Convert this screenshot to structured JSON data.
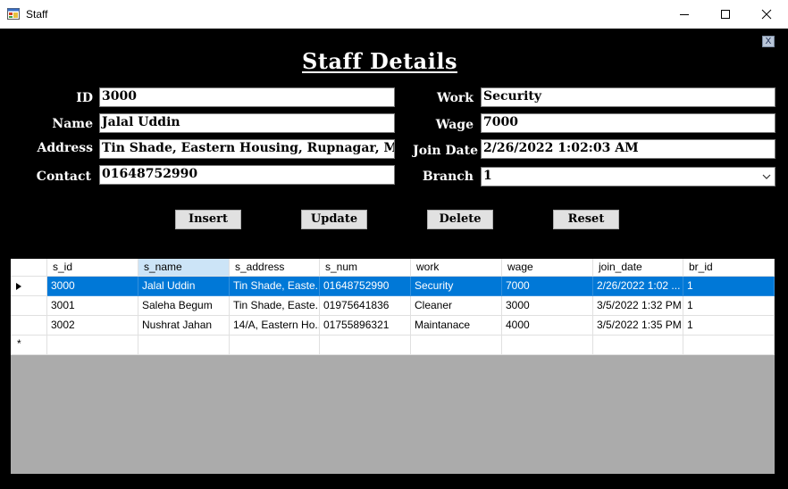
{
  "window": {
    "title": "Staff"
  },
  "form": {
    "heading": "Staff Details",
    "close_glyph": "X",
    "labels": {
      "id": "ID",
      "name": "Name",
      "address": "Address",
      "contact": "Contact",
      "work": "Work",
      "wage": "Wage",
      "join_date": "Join Date",
      "branch": "Branch"
    },
    "values": {
      "id": "3000",
      "name": "Jalal Uddin",
      "address": "Tin Shade, Eastern Housing, Rupnagar, Mirp",
      "contact": "01648752990",
      "work": "Security",
      "wage": "7000",
      "join_date": "2/26/2022 1:02:03 AM",
      "branch": "1"
    },
    "buttons": {
      "insert": "Insert",
      "update": "Update",
      "delete": "Delete",
      "reset": "Reset"
    }
  },
  "grid": {
    "columns": [
      "s_id",
      "s_name",
      "s_address",
      "s_num",
      "work",
      "wage",
      "join_date",
      "br_id"
    ],
    "rows": [
      [
        "3000",
        "Jalal Uddin",
        "Tin Shade, Easte...",
        "01648752990",
        "Security",
        "7000",
        "2/26/2022 1:02 ...",
        "1"
      ],
      [
        "3001",
        "Saleha Begum",
        "Tin Shade, Easte...",
        "01975641836",
        "Cleaner",
        "3000",
        "3/5/2022 1:32 PM",
        "1"
      ],
      [
        "3002",
        "Nushrat Jahan",
        "14/A, Eastern Ho...",
        "01755896321",
        "Maintanace",
        "4000",
        "3/5/2022 1:35 PM",
        "1"
      ]
    ],
    "selected_row": 0,
    "new_row_marker": "*"
  },
  "colors": {
    "selection": "#0078d7",
    "form_background": "#000000",
    "grid_background": "#ababab"
  }
}
